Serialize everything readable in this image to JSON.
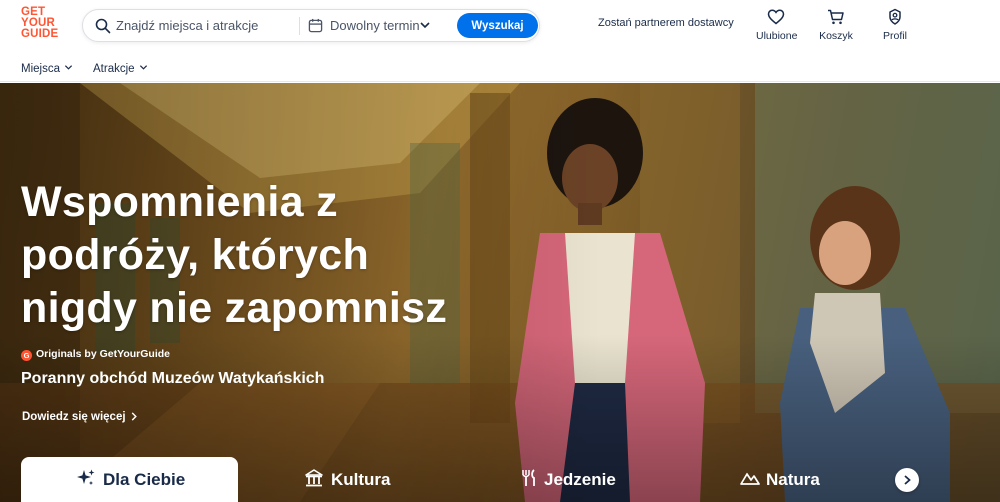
{
  "brand": {
    "logo_line1": "GET",
    "logo_line2": "YOUR",
    "logo_line3": "GUIDE",
    "color": "#ff5533"
  },
  "search": {
    "placeholder": "Znajdź miejsca i atrakcje",
    "date_label": "Dowolny termin",
    "button_label": "Wyszukaj",
    "button_color": "#0071eb"
  },
  "header": {
    "partner_link": "Zostań partnerem dostawcy",
    "favorites": "Ulubione",
    "cart": "Koszyk",
    "profile": "Profil"
  },
  "subnav": {
    "places": "Miejsca",
    "attractions": "Atrakcje"
  },
  "hero": {
    "headline_line1": "Wspomnienia z",
    "headline_line2": "podróży, których",
    "headline_line3": "nigdy nie zapomnisz",
    "originals_label": "Originals by GetYourGuide",
    "originals_badge": "G",
    "tour_title": "Poranny obchód Muzeów Watykańskich",
    "learn_more": "Dowiedz się więcej"
  },
  "tabs": [
    {
      "label": "Dla Ciebie",
      "icon": "sparkles-icon",
      "active": true
    },
    {
      "label": "Kultura",
      "icon": "museum-icon",
      "active": false
    },
    {
      "label": "Jedzenie",
      "icon": "cutlery-icon",
      "active": false
    },
    {
      "label": "Natura",
      "icon": "mountain-icon",
      "active": false
    }
  ],
  "colors": {
    "text_dark": "#1a2b49",
    "accent": "#0071eb"
  }
}
